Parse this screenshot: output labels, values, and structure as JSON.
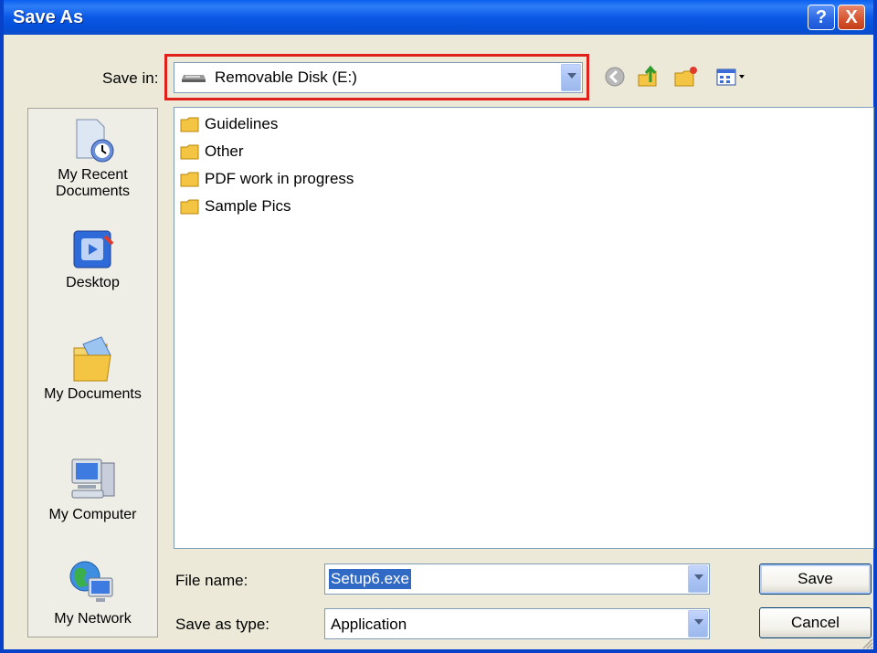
{
  "window": {
    "title": "Save As",
    "help_label": "?",
    "close_label": "X"
  },
  "save_in": {
    "label": "Save in:",
    "value": "Removable Disk (E:)"
  },
  "toolbar": {
    "icons": [
      "back-icon",
      "up-folder-icon",
      "new-folder-icon",
      "views-icon"
    ]
  },
  "places": [
    {
      "label_line1": "My Recent",
      "label_line2": "Documents",
      "icon": "recent-documents-icon"
    },
    {
      "label_line1": "Desktop",
      "label_line2": "",
      "icon": "desktop-icon"
    },
    {
      "label_line1": "My Documents",
      "label_line2": "",
      "icon": "my-documents-icon"
    },
    {
      "label_line1": "My Computer",
      "label_line2": "",
      "icon": "my-computer-icon"
    },
    {
      "label_line1": "My Network",
      "label_line2": "",
      "icon": "my-network-icon"
    }
  ],
  "files": [
    {
      "name": "Guidelines"
    },
    {
      "name": "Other"
    },
    {
      "name": "PDF work in progress"
    },
    {
      "name": "Sample Pics"
    }
  ],
  "file_name": {
    "label": "File name:",
    "value": "Setup6.exe"
  },
  "save_as_type": {
    "label": "Save as type:",
    "value": "Application"
  },
  "buttons": {
    "save": "Save",
    "cancel": "Cancel"
  },
  "colors": {
    "titlebar": "#0A58E6",
    "highlight": "#E0201B",
    "selection": "#316AC5",
    "folder": "#F4C542"
  }
}
